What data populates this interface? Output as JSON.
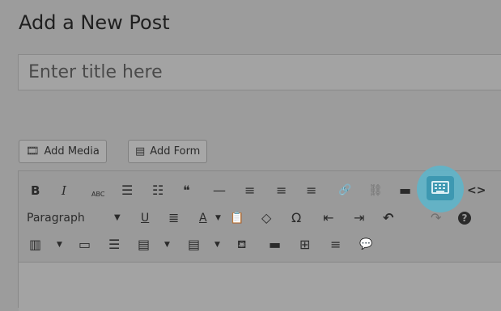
{
  "header": {
    "title": "Add a New Post"
  },
  "title_field": {
    "placeholder": "Enter title here"
  },
  "media_buttons": [
    {
      "label": "Add Media",
      "icon": "media-icon"
    },
    {
      "label": "Add Form",
      "icon": "form-icon"
    }
  ],
  "toolbar": {
    "row1": [
      {
        "glyph": "B",
        "name": "bold-icon"
      },
      {
        "glyph": "I",
        "name": "italic-icon"
      },
      {
        "glyph": "ABC",
        "name": "strikethrough-icon"
      },
      {
        "glyph": "☰",
        "name": "bulleted-list-icon"
      },
      {
        "glyph": "☷",
        "name": "numbered-list-icon"
      },
      {
        "glyph": "❝",
        "name": "blockquote-icon"
      },
      {
        "glyph": "—",
        "name": "horizontal-line-icon"
      },
      {
        "glyph": "≡",
        "name": "align-left-icon"
      },
      {
        "glyph": "≡",
        "name": "align-center-icon"
      },
      {
        "glyph": "≡",
        "name": "align-right-icon"
      },
      {
        "glyph": "🔗",
        "name": "insert-link-icon"
      },
      {
        "glyph": "⛓",
        "name": "remove-link-icon"
      },
      {
        "glyph": "▬",
        "name": "read-more-icon"
      },
      {
        "glyph": "⌨",
        "name": "toolbar-toggle-icon"
      },
      {
        "glyph": "<>",
        "name": "code-icon"
      }
    ],
    "format_select": {
      "value": "Paragraph",
      "arrow": "▼"
    },
    "row2": [
      {
        "glyph": "U",
        "name": "underline-icon"
      },
      {
        "glyph": "≣",
        "name": "justify-icon"
      },
      {
        "glyph": "A",
        "name": "text-color-icon"
      },
      {
        "glyph": "▼",
        "name": "text-color-dropdown-icon"
      },
      {
        "glyph": "📋",
        "name": "paste-as-text-icon"
      },
      {
        "glyph": "◇",
        "name": "clear-formatting-icon"
      },
      {
        "glyph": "Ω",
        "name": "special-character-icon"
      },
      {
        "glyph": "⇤",
        "name": "outdent-icon"
      },
      {
        "glyph": "⇥",
        "name": "indent-icon"
      },
      {
        "glyph": "↶",
        "name": "undo-icon"
      },
      {
        "glyph": "↷",
        "name": "redo-icon"
      },
      {
        "glyph": "?",
        "name": "help-icon"
      }
    ],
    "row3": [
      {
        "glyph": "▥",
        "name": "table-icon"
      },
      {
        "glyph": "▼",
        "name": "table-dropdown-icon"
      },
      {
        "glyph": "▭",
        "name": "tab-icon"
      },
      {
        "glyph": "☰",
        "name": "accordion-icon"
      },
      {
        "glyph": "▤",
        "name": "list-group-icon"
      },
      {
        "glyph": "▼",
        "name": "list-group-dropdown-icon"
      },
      {
        "glyph": "▤",
        "name": "panel-icon"
      },
      {
        "glyph": "▼",
        "name": "panel-dropdown-icon"
      },
      {
        "glyph": "⛾",
        "name": "tooltip-icon"
      },
      {
        "glyph": "▬",
        "name": "label-icon"
      },
      {
        "glyph": "⊞",
        "name": "add-element-icon"
      },
      {
        "glyph": "≡",
        "name": "paragraph-icon"
      },
      {
        "glyph": "💬",
        "name": "speech-bubble-icon"
      }
    ]
  },
  "colors": {
    "highlight": "#5bb6cc",
    "overlay_bg": "#9c9c9c"
  }
}
